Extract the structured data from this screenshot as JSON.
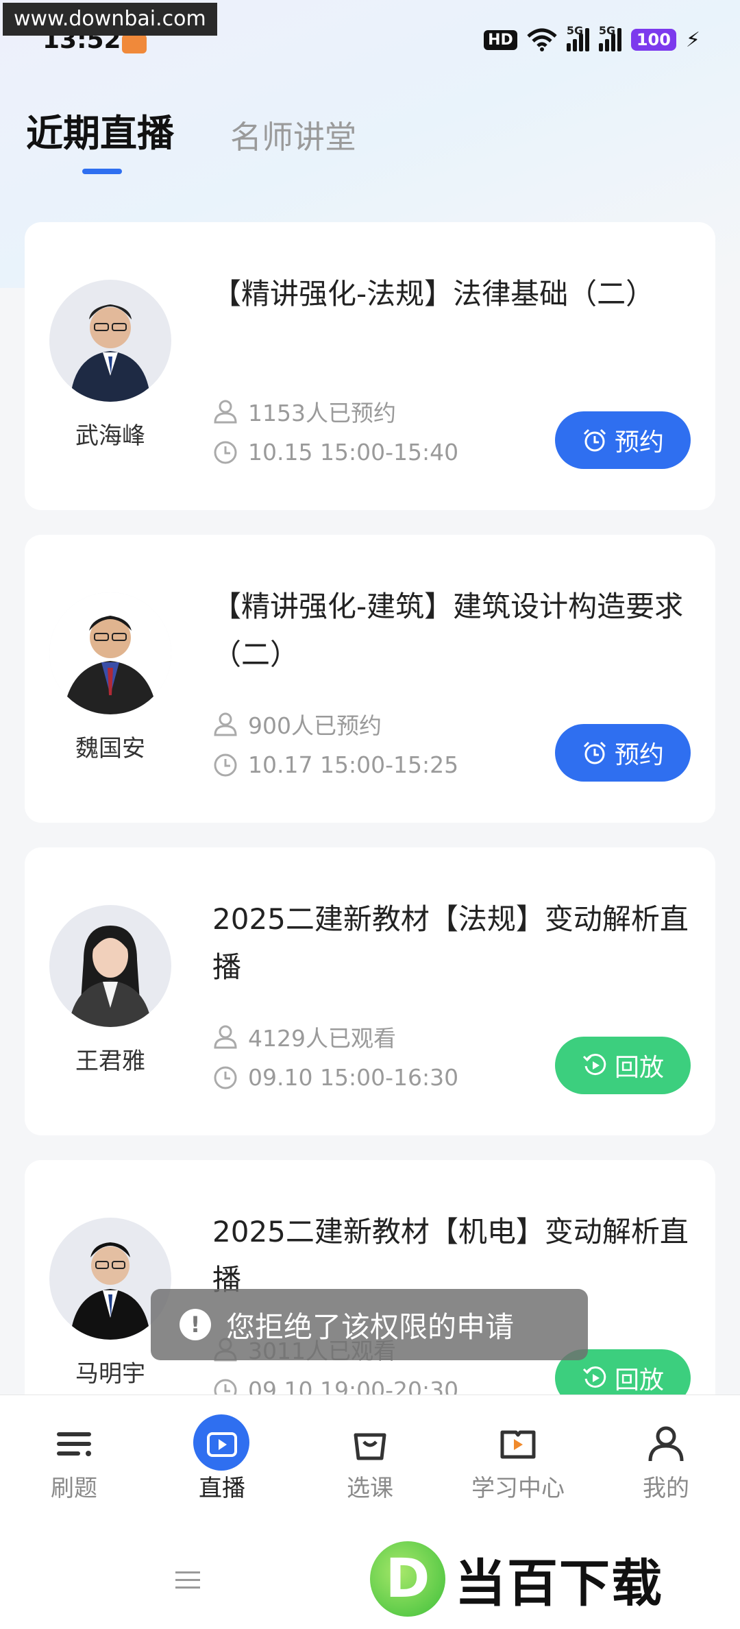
{
  "watermark_url": "www.downbai.com",
  "status_bar": {
    "time": "13:52",
    "hd": "HD",
    "net1": "5G",
    "net2": "5G",
    "battery": "100"
  },
  "tabs": [
    {
      "label": "近期直播",
      "active": true
    },
    {
      "label": "名师讲堂",
      "active": false
    }
  ],
  "cards": [
    {
      "teacher": "武海峰",
      "title": "【精讲强化-法规】法律基础（二）",
      "count": "1153人已预约",
      "time": "10.15 15:00-15:40",
      "button": "预约",
      "button_type": "reserve"
    },
    {
      "teacher": "魏国安",
      "title": "【精讲强化-建筑】建筑设计构造要求（二）",
      "count": "900人已预约",
      "time": "10.17 15:00-15:25",
      "button": "预约",
      "button_type": "reserve"
    },
    {
      "teacher": "王君雅",
      "title": "2025二建新教材【法规】变动解析直播",
      "count": "4129人已观看",
      "time": "09.10 15:00-16:30",
      "button": "回放",
      "button_type": "replay"
    },
    {
      "teacher": "马明宇",
      "title": "2025二建新教材【机电】变动解析直播",
      "count": "3011人已观看",
      "time": "09.10 19:00-20:30",
      "button": "回放",
      "button_type": "replay"
    }
  ],
  "toast": {
    "text": "您拒绝了该权限的申请",
    "icon": "exclamation-icon"
  },
  "bottom_nav": [
    {
      "label": "刷题",
      "icon": "list-icon"
    },
    {
      "label": "直播",
      "icon": "live-play-icon",
      "active": true
    },
    {
      "label": "选课",
      "icon": "shopping-bag-icon"
    },
    {
      "label": "学习中心",
      "icon": "study-book-icon"
    },
    {
      "label": "我的",
      "icon": "person-icon"
    }
  ],
  "colors": {
    "accent": "#2f6ff0",
    "replay": "#3ccf7e",
    "muted": "#9a9a9a"
  },
  "brand_watermark": {
    "letter": "D",
    "text": "当百下载"
  }
}
